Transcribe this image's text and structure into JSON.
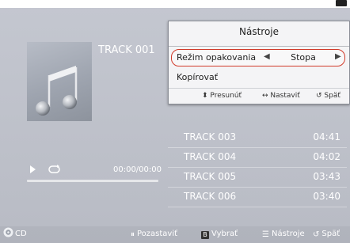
{
  "now_playing": {
    "title": "TRACK 001",
    "time": "00:00/00:00",
    "progress": 0
  },
  "tracks": [
    {
      "title": "TRACK 003",
      "duration": "04:41"
    },
    {
      "title": "TRACK 004",
      "duration": "04:02"
    },
    {
      "title": "TRACK 005",
      "duration": "03:43"
    },
    {
      "title": "TRACK 006",
      "duration": "03:40"
    }
  ],
  "tools_popup": {
    "title": "Nástroje",
    "repeat_label": "Režim opakovania",
    "repeat_value": "Stopa",
    "copy_label": "Kopírovať",
    "hint_move": "Presunúť",
    "hint_set": "Nastaviť",
    "hint_back": "Späť"
  },
  "footer": {
    "source": "CD",
    "pause": "Pozastaviť",
    "select_key": "B",
    "select": "Vybrať",
    "tools": "Nástroje",
    "back": "Späť"
  },
  "colors": {
    "background": "#c0c3cc",
    "focus_outline": "#d13a2a",
    "popup_background": "#f4f4f6"
  }
}
